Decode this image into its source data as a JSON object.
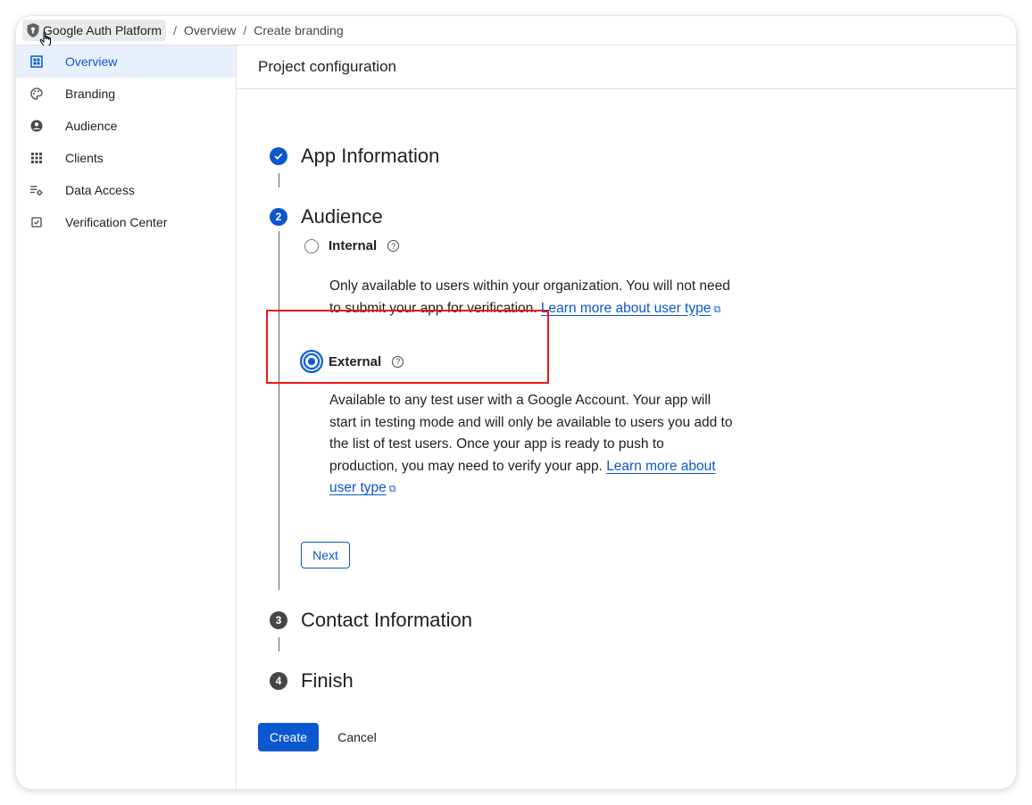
{
  "breadcrumb": {
    "items": [
      "Google Auth Platform",
      "Overview",
      "Create branding"
    ],
    "separator": "/"
  },
  "sidebar": {
    "items": [
      {
        "label": "Overview",
        "icon": "dashboard-icon",
        "active": true
      },
      {
        "label": "Branding",
        "icon": "palette-icon",
        "active": false
      },
      {
        "label": "Audience",
        "icon": "account-circle-icon",
        "active": false
      },
      {
        "label": "Clients",
        "icon": "apps-grid-icon",
        "active": false
      },
      {
        "label": "Data Access",
        "icon": "list-settings-icon",
        "active": false
      },
      {
        "label": "Verification Center",
        "icon": "checkbox-icon",
        "active": false
      }
    ]
  },
  "main": {
    "header": "Project configuration",
    "steps": [
      {
        "number": "1",
        "title": "App Information",
        "state": "completed"
      },
      {
        "number": "2",
        "title": "Audience",
        "state": "active"
      },
      {
        "number": "3",
        "title": "Contact Information",
        "state": "pending"
      },
      {
        "number": "4",
        "title": "Finish",
        "state": "pending"
      }
    ],
    "audience": {
      "options": [
        {
          "label": "Internal",
          "selected": false,
          "description": "Only available to users within your organization. You will not need to submit your app for verification.",
          "link_text": "Learn more about user type"
        },
        {
          "label": "External",
          "selected": true,
          "description": "Available to any test user with a Google Account. Your app will start in testing mode and will only be available to users you add to the list of test users. Once your app is ready to push to production, you may need to verify your app.",
          "link_text": "Learn more about user type"
        }
      ],
      "next_label": "Next"
    },
    "create_label": "Create",
    "cancel_label": "Cancel"
  },
  "colors": {
    "accent": "#0b57d0",
    "active_nav_bg": "#e8f0fe",
    "highlight": "#e8191b"
  }
}
